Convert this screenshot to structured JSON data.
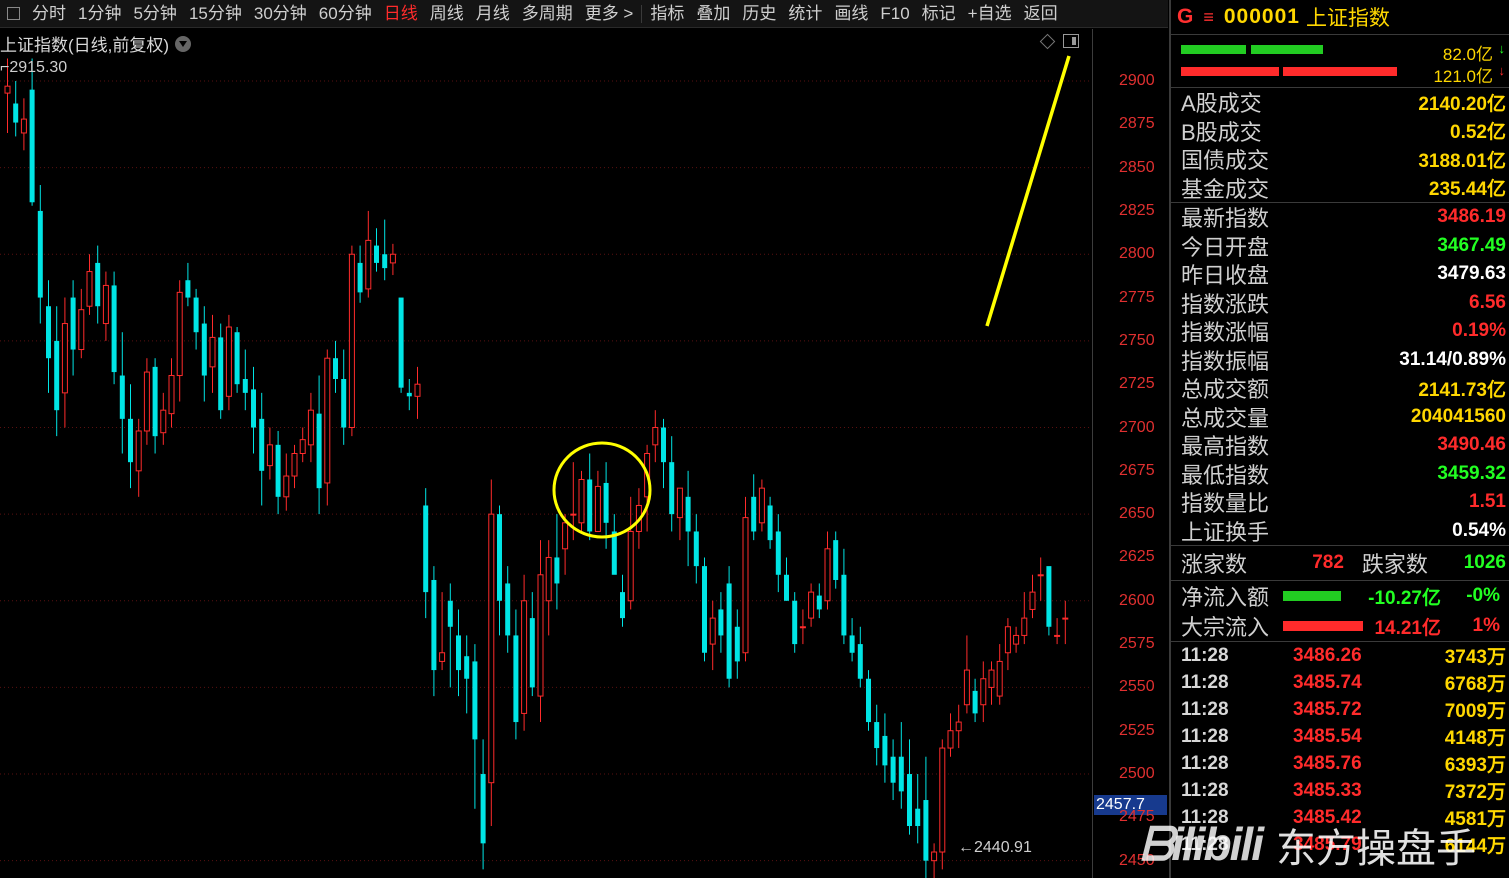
{
  "toolbar": {
    "items": [
      "分时",
      "1分钟",
      "5分钟",
      "15分钟",
      "30分钟",
      "60分钟",
      "日线",
      "周线",
      "月线",
      "多周期",
      "更多 >",
      "指标",
      "叠加",
      "历史",
      "统计",
      "画线",
      "F10",
      "标记",
      "+自选",
      "返回"
    ],
    "active": "日线"
  },
  "chart": {
    "title": "上证指数(日线,前复权)",
    "max_label": "2915.30",
    "min_label": "2440.91",
    "current_price_tag": "2457.7",
    "y_ticks": [
      "2900",
      "2875",
      "2850",
      "2825",
      "2800",
      "2775",
      "2750",
      "2725",
      "2700",
      "2675",
      "2650",
      "2625",
      "2600",
      "2575",
      "2550",
      "2525",
      "2500",
      "2475",
      "2450"
    ],
    "colors": {
      "up": "#ff2b2b",
      "down": "#00e5e5",
      "annotation": "#ffff00",
      "grid": "#5a1010"
    }
  },
  "chart_data": {
    "type": "candlestick",
    "y_range": [
      2440,
      2930
    ],
    "candles": [
      [
        2893,
        2913,
        2897,
        2870
      ],
      [
        2887,
        2900,
        2876,
        2868
      ],
      [
        2870,
        2890,
        2878,
        2860
      ],
      [
        2895,
        2913,
        2830,
        2828
      ],
      [
        2825,
        2840,
        2775,
        2760
      ],
      [
        2770,
        2785,
        2740,
        2720
      ],
      [
        2750,
        2770,
        2710,
        2695
      ],
      [
        2720,
        2775,
        2760,
        2700
      ],
      [
        2775,
        2785,
        2745,
        2730
      ],
      [
        2745,
        2780,
        2768,
        2740
      ],
      [
        2770,
        2800,
        2790,
        2765
      ],
      [
        2795,
        2805,
        2770,
        2760
      ],
      [
        2760,
        2790,
        2782,
        2750
      ],
      [
        2782,
        2790,
        2732,
        2725
      ],
      [
        2730,
        2755,
        2705,
        2685
      ],
      [
        2705,
        2725,
        2680,
        2665
      ],
      [
        2675,
        2705,
        2698,
        2660
      ],
      [
        2698,
        2740,
        2732,
        2690
      ],
      [
        2735,
        2740,
        2695,
        2685
      ],
      [
        2697,
        2720,
        2710,
        2690
      ],
      [
        2708,
        2740,
        2730,
        2700
      ],
      [
        2730,
        2785,
        2778,
        2715
      ],
      [
        2785,
        2795,
        2775,
        2770
      ],
      [
        2775,
        2780,
        2755,
        2745
      ],
      [
        2760,
        2770,
        2730,
        2715
      ],
      [
        2735,
        2765,
        2752,
        2720
      ],
      [
        2752,
        2760,
        2710,
        2705
      ],
      [
        2718,
        2765,
        2758,
        2710
      ],
      [
        2755,
        2758,
        2725,
        2720
      ],
      [
        2728,
        2745,
        2720,
        2710
      ],
      [
        2722,
        2735,
        2700,
        2685
      ],
      [
        2705,
        2720,
        2675,
        2655
      ],
      [
        2678,
        2700,
        2690,
        2670
      ],
      [
        2690,
        2698,
        2660,
        2650
      ],
      [
        2660,
        2685,
        2672,
        2652
      ],
      [
        2672,
        2690,
        2685,
        2665
      ],
      [
        2685,
        2700,
        2693,
        2680
      ],
      [
        2690,
        2720,
        2710,
        2680
      ],
      [
        2708,
        2730,
        2665,
        2650
      ],
      [
        2668,
        2745,
        2740,
        2655
      ],
      [
        2740,
        2750,
        2728,
        2720
      ],
      [
        2728,
        2745,
        2700,
        2690
      ],
      [
        2700,
        2805,
        2800,
        2695
      ],
      [
        2795,
        2805,
        2778,
        2772
      ],
      [
        2780,
        2825,
        2808,
        2775
      ],
      [
        2805,
        2815,
        2795,
        2790
      ],
      [
        2800,
        2820,
        2792,
        2785
      ],
      [
        2795,
        2806,
        2800,
        2788
      ],
      [
        2775,
        2765,
        2723,
        2720
      ],
      [
        2720,
        2728,
        2718,
        2710
      ],
      [
        2718,
        2735,
        2725,
        2705
      ],
      [
        2655,
        2665,
        2605,
        2590
      ],
      [
        2612,
        2620,
        2560,
        2545
      ],
      [
        2565,
        2605,
        2570,
        2560
      ],
      [
        2600,
        2610,
        2585,
        2550
      ],
      [
        2580,
        2595,
        2560,
        2545
      ],
      [
        2568,
        2580,
        2555,
        2535
      ],
      [
        2565,
        2575,
        2520,
        2480
      ],
      [
        2500,
        2520,
        2460,
        2445
      ],
      [
        2495,
        2670,
        2650,
        2470
      ],
      [
        2650,
        2655,
        2600,
        2580
      ],
      [
        2610,
        2620,
        2580,
        2570
      ],
      [
        2580,
        2595,
        2530,
        2520
      ],
      [
        2535,
        2615,
        2600,
        2525
      ],
      [
        2590,
        2605,
        2550,
        2545
      ],
      [
        2545,
        2635,
        2615,
        2530
      ],
      [
        2600,
        2635,
        2625,
        2580
      ],
      [
        2625,
        2650,
        2610,
        2595
      ],
      [
        2630,
        2650,
        2645,
        2615
      ],
      [
        2650,
        2680,
        2650,
        2635
      ],
      [
        2645,
        2675,
        2670,
        2640
      ],
      [
        2670,
        2685,
        2640,
        2635
      ],
      [
        2640,
        2675,
        2666,
        2640
      ],
      [
        2668,
        2680,
        2645,
        2630
      ],
      [
        2640,
        2650,
        2615,
        2625
      ],
      [
        2605,
        2615,
        2590,
        2585
      ],
      [
        2600,
        2660,
        2640,
        2595
      ],
      [
        2640,
        2665,
        2655,
        2630
      ],
      [
        2660,
        2690,
        2685,
        2640
      ],
      [
        2690,
        2710,
        2700,
        2680
      ],
      [
        2700,
        2705,
        2680,
        2665
      ],
      [
        2680,
        2695,
        2650,
        2640
      ],
      [
        2648,
        2665,
        2665,
        2635
      ],
      [
        2660,
        2675,
        2640,
        2620
      ],
      [
        2640,
        2650,
        2620,
        2610
      ],
      [
        2620,
        2625,
        2570,
        2565
      ],
      [
        2575,
        2600,
        2590,
        2560
      ],
      [
        2595,
        2605,
        2580,
        2570
      ],
      [
        2610,
        2620,
        2555,
        2550
      ],
      [
        2585,
        2595,
        2565,
        2555
      ],
      [
        2570,
        2660,
        2648,
        2565
      ],
      [
        2660,
        2673,
        2640,
        2635
      ],
      [
        2645,
        2670,
        2665,
        2640
      ],
      [
        2655,
        2660,
        2635,
        2630
      ],
      [
        2640,
        2650,
        2615,
        2605
      ],
      [
        2615,
        2625,
        2600,
        2600
      ],
      [
        2600,
        2605,
        2575,
        2570
      ],
      [
        2585,
        2595,
        2585,
        2575
      ],
      [
        2590,
        2610,
        2605,
        2585
      ],
      [
        2603,
        2610,
        2595,
        2590
      ],
      [
        2600,
        2640,
        2630,
        2595
      ],
      [
        2635,
        2640,
        2612,
        2607
      ],
      [
        2615,
        2630,
        2580,
        2575
      ],
      [
        2580,
        2590,
        2570,
        2565
      ],
      [
        2575,
        2585,
        2555,
        2550
      ],
      [
        2555,
        2560,
        2530,
        2525
      ],
      [
        2530,
        2540,
        2515,
        2505
      ],
      [
        2522,
        2535,
        2505,
        2495
      ],
      [
        2510,
        2520,
        2495,
        2485
      ],
      [
        2510,
        2530,
        2490,
        2480
      ],
      [
        2500,
        2520,
        2470,
        2465
      ],
      [
        2480,
        2500,
        2470,
        2460
      ],
      [
        2485,
        2510,
        2450,
        2440
      ],
      [
        2450,
        2460,
        2455,
        2440
      ],
      [
        2455,
        2520,
        2515,
        2445
      ],
      [
        2515,
        2535,
        2525,
        2510
      ],
      [
        2525,
        2540,
        2530,
        2515
      ],
      [
        2540,
        2580,
        2560,
        2535
      ],
      [
        2548,
        2555,
        2535,
        2530
      ],
      [
        2540,
        2565,
        2555,
        2530
      ],
      [
        2550,
        2565,
        2560,
        2540
      ],
      [
        2545,
        2575,
        2565,
        2540
      ],
      [
        2570,
        2590,
        2585,
        2560
      ],
      [
        2575,
        2585,
        2580,
        2570
      ],
      [
        2580,
        2605,
        2590,
        2575
      ],
      [
        2595,
        2615,
        2605,
        2590
      ],
      [
        2615,
        2625,
        2615,
        2600
      ],
      [
        2620,
        2615,
        2585,
        2580
      ],
      [
        2580,
        2590,
        2580,
        2575
      ],
      [
        2590,
        2600,
        2590,
        2575
      ]
    ],
    "annotations": [
      "yellow circle around consolidation",
      "yellow upward trend line"
    ]
  },
  "panel": {
    "header": {
      "g_icon": "G",
      "menu_icon": "≡",
      "code": "000001",
      "name": "上证指数"
    },
    "bars": [
      {
        "value": "82.0亿",
        "arrow": "↓",
        "arrow_color": "#22ff22",
        "color": "#22cc22"
      },
      {
        "value": "121.0亿",
        "arrow": "↓",
        "arrow_color": "#ff2b2b",
        "color": "#ff2b2b"
      }
    ],
    "turnover": [
      {
        "label": "A股成交",
        "value": "2140.20亿",
        "color": "yellow"
      },
      {
        "label": "B股成交",
        "value": "0.52亿",
        "color": "yellow"
      },
      {
        "label": "国债成交",
        "value": "3188.01亿",
        "color": "yellow"
      },
      {
        "label": "基金成交",
        "value": "235.44亿",
        "color": "yellow"
      }
    ],
    "stats": [
      {
        "label": "最新指数",
        "value": "3486.19",
        "color": "red"
      },
      {
        "label": "今日开盘",
        "value": "3467.49",
        "color": "green"
      },
      {
        "label": "昨日收盘",
        "value": "3479.63",
        "color": "white"
      },
      {
        "label": "指数涨跌",
        "value": "6.56",
        "color": "red"
      },
      {
        "label": "指数涨幅",
        "value": "0.19%",
        "color": "red"
      },
      {
        "label": "指数振幅",
        "value": "31.14/0.89%",
        "color": "white"
      },
      {
        "label": "总成交额",
        "value": "2141.73亿",
        "color": "yellow"
      },
      {
        "label": "总成交量",
        "value": "204041560",
        "color": "yellow"
      },
      {
        "label": "最高指数",
        "value": "3490.46",
        "color": "red"
      },
      {
        "label": "最低指数",
        "value": "3459.32",
        "color": "green"
      },
      {
        "label": "指数量比",
        "value": "1.51",
        "color": "red"
      },
      {
        "label": "上证换手",
        "value": "0.54%",
        "color": "white"
      }
    ],
    "counts": {
      "up_label": "涨家数",
      "up_value": "782",
      "down_label": "跌家数",
      "down_value": "1026"
    },
    "flows": [
      {
        "label": "净流入额",
        "bar_color": "#22cc22",
        "value": "-10.27亿",
        "pct": "-0%",
        "color": "green"
      },
      {
        "label": "大宗流入",
        "bar_color": "#ff2b2b",
        "value": "14.21亿",
        "pct": "1%",
        "color": "red"
      }
    ],
    "ticks": [
      {
        "time": "11:28",
        "price": "3486.26",
        "vol": "3743万"
      },
      {
        "time": "11:28",
        "price": "3485.74",
        "vol": "6768万"
      },
      {
        "time": "11:28",
        "price": "3485.72",
        "vol": "7009万"
      },
      {
        "time": "11:28",
        "price": "3485.54",
        "vol": "4148万"
      },
      {
        "time": "11:28",
        "price": "3485.76",
        "vol": "6393万"
      },
      {
        "time": "11:28",
        "price": "3485.33",
        "vol": "7372万"
      },
      {
        "time": "11:28",
        "price": "3485.42",
        "vol": "4581万"
      },
      {
        "time": "11:28",
        "price": "3485.79",
        "vol": "6144万"
      }
    ]
  },
  "watermark": {
    "logo": "bilibili",
    "brand": "东方操盘手"
  }
}
